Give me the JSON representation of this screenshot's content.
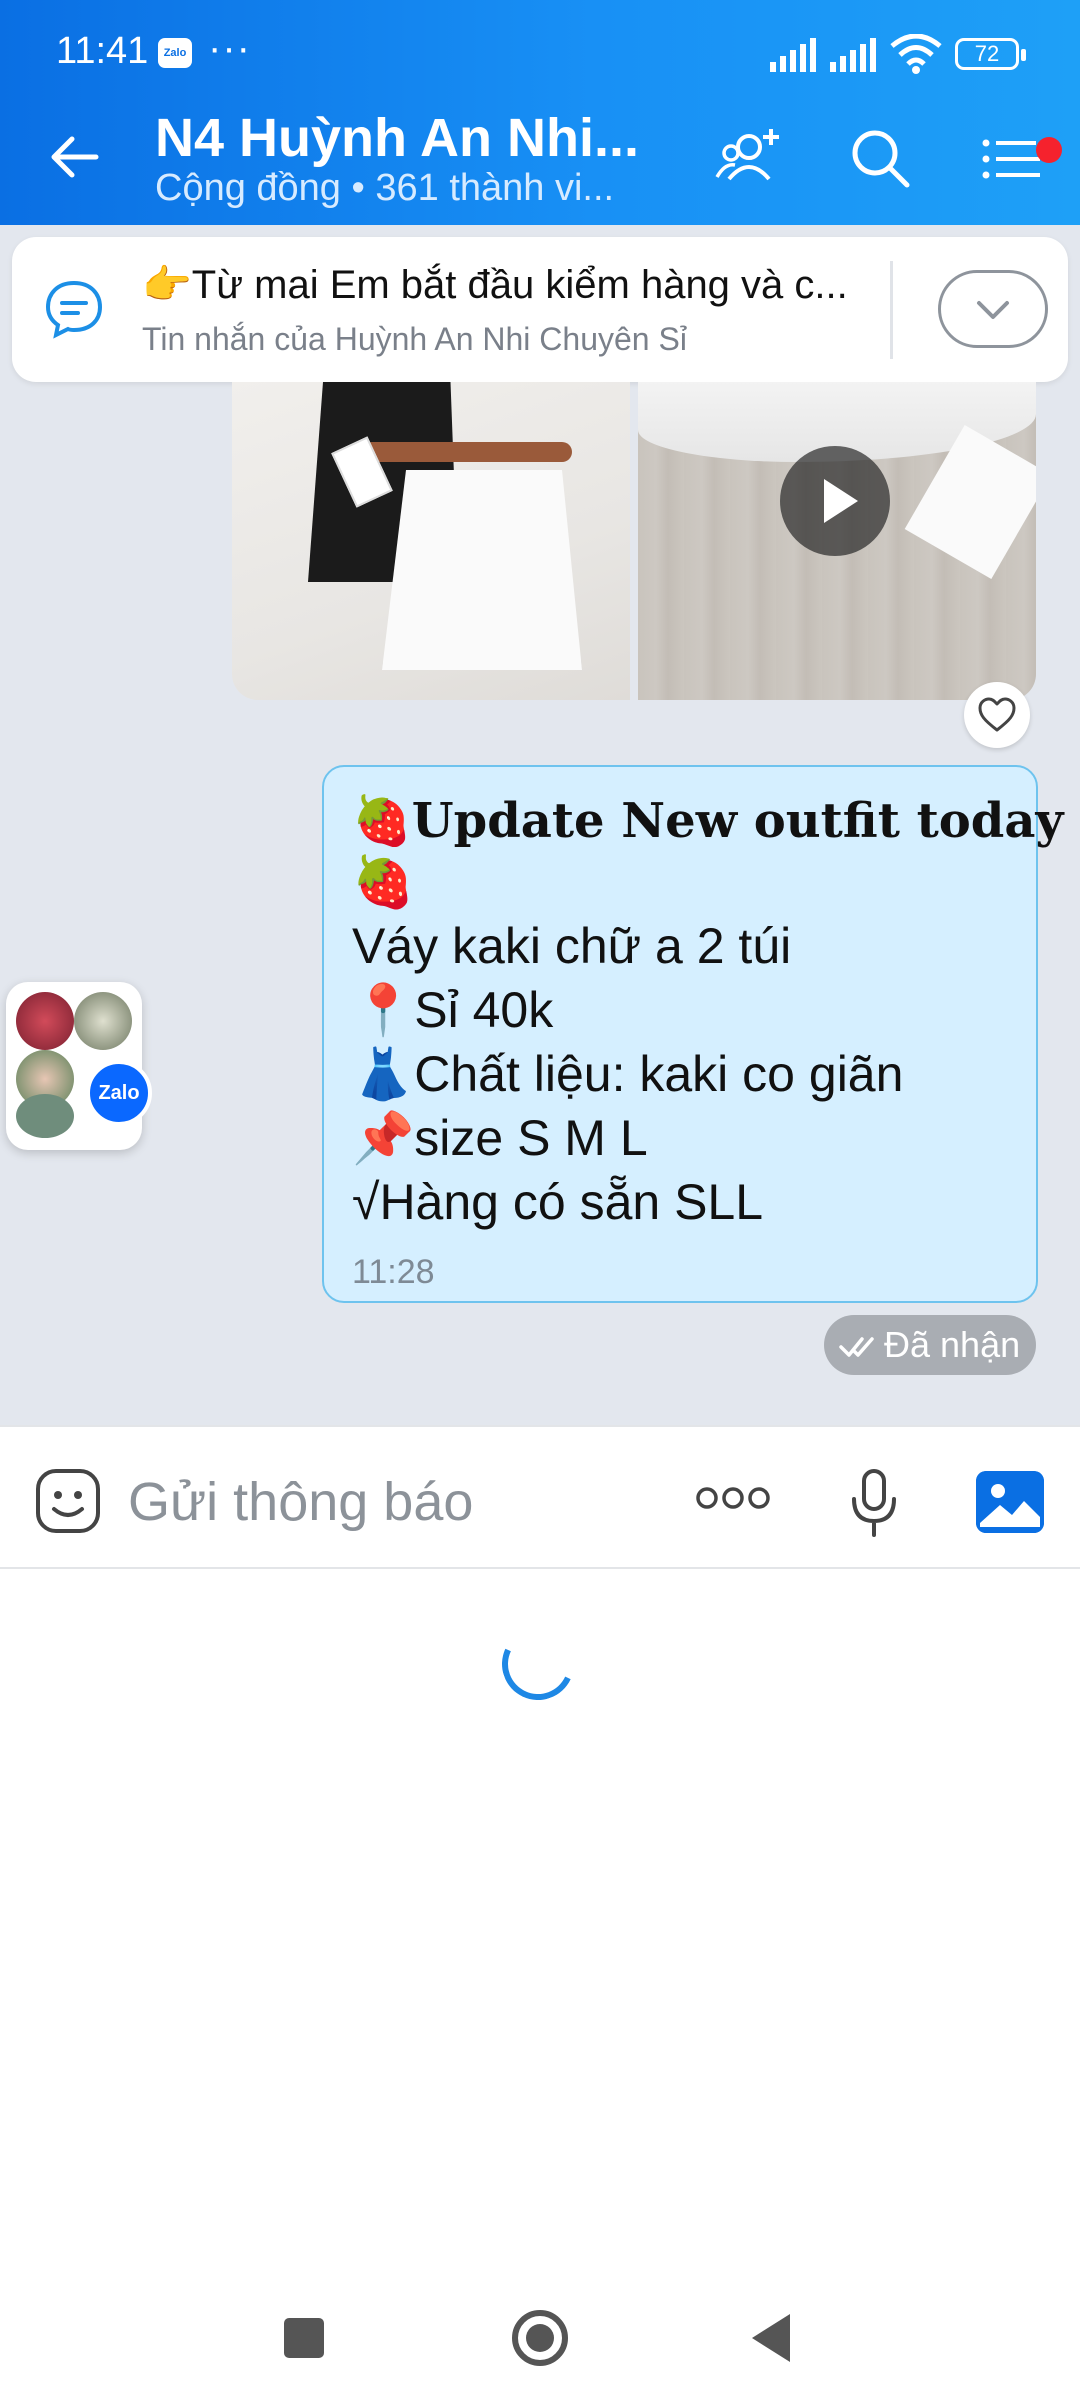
{
  "status_bar": {
    "time": "11:41",
    "app_icon_label": "Zalo",
    "more_dots": "···",
    "battery": "72"
  },
  "header": {
    "title": "N4 Huỳnh An Nhi...",
    "subtitle": "Cộng đồng • 361 thành vi...",
    "accent_color": "#0a6fe3",
    "icons": [
      "back-arrow-icon",
      "add-member-icon",
      "search-icon",
      "menu-icon"
    ]
  },
  "pinned_message": {
    "text": "👉Từ mai Em bắt đầu kiểm hàng và c...",
    "sender": "Tin nhắn của Huỳnh An Nhi Chuyên Sỉ"
  },
  "message": {
    "headline": "🍓Update New outfit today",
    "headline_tail": "🍓",
    "line1": "Váy kaki chữ a 2 túi",
    "line2": "📍Sỉ 40k",
    "line3": "👗Chất liệu: kaki co giãn",
    "line4": "📌size S M L",
    "line5": "√Hàng có sẵn SLL",
    "time": "11:28",
    "bubble_color": "#d5efff"
  },
  "receipt": {
    "status": "Đã nhận"
  },
  "floating_bubble": {
    "badge": "Zalo"
  },
  "composer": {
    "placeholder": "Gửi thông báo",
    "more_label": "ooo"
  }
}
